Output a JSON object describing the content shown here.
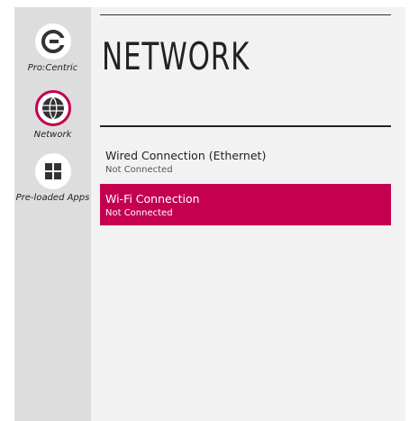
{
  "sidebar": {
    "items": [
      {
        "label": "Pro:Centric",
        "icon": "pro-centric-icon"
      },
      {
        "label": "Network",
        "icon": "network-globe-icon",
        "active": true
      },
      {
        "label": "Pre-loaded Apps",
        "icon": "apps-grid-icon"
      }
    ]
  },
  "main": {
    "title": "NETWORK",
    "connections": [
      {
        "name": "Wired Connection (Ethernet)",
        "status": "Not Connected"
      },
      {
        "name": "Wi-Fi Connection",
        "status": "Not Connected",
        "selected": true
      }
    ]
  },
  "colors": {
    "accent": "#c4004f",
    "sidebar_bg": "#dddddd",
    "panel_bg": "#f2f2f2"
  }
}
